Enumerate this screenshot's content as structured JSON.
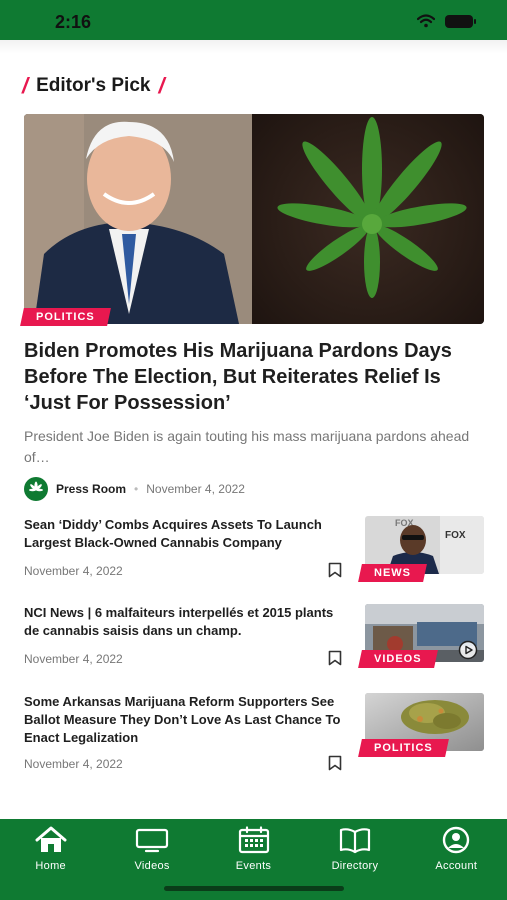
{
  "status_bar": {
    "time": "2:16"
  },
  "section": {
    "title": "Editor's Pick"
  },
  "hero": {
    "category": "POLITICS",
    "title": "Biden Promotes His Marijuana Pardons Days Before The Election, But Reiterates Relief Is ‘Just For Possession’",
    "excerpt": "President Joe Biden is again touting his mass marijuana pardons ahead of…",
    "author": "Press Room",
    "date": "November 4, 2022"
  },
  "articles": [
    {
      "title": "Sean ‘Diddy’ Combs Acquires Assets To Launch Largest Black-Owned Cannabis Company",
      "date": "November 4, 2022",
      "category": "NEWS"
    },
    {
      "title": "NCI News | 6 malfaiteurs interpellés et 2015 plants de cannabis saisis dans un champ.",
      "date": "November 4, 2022",
      "category": "VIDEOS"
    },
    {
      "title": "Some Arkansas Marijuana Reform Supporters See Ballot Measure They Don’t Love As Last Chance To Enact Legalization",
      "date": "November 4, 2022",
      "category": "POLITICS"
    }
  ],
  "nav": {
    "items": [
      {
        "label": "Home",
        "icon": "home-icon"
      },
      {
        "label": "Videos",
        "icon": "monitor-icon"
      },
      {
        "label": "Events",
        "icon": "calendar-icon"
      },
      {
        "label": "Directory",
        "icon": "book-icon"
      },
      {
        "label": "Account",
        "icon": "user-circle-icon"
      }
    ]
  },
  "colors": {
    "brand_green": "#0f7a32",
    "accent_pink": "#e8184f"
  }
}
